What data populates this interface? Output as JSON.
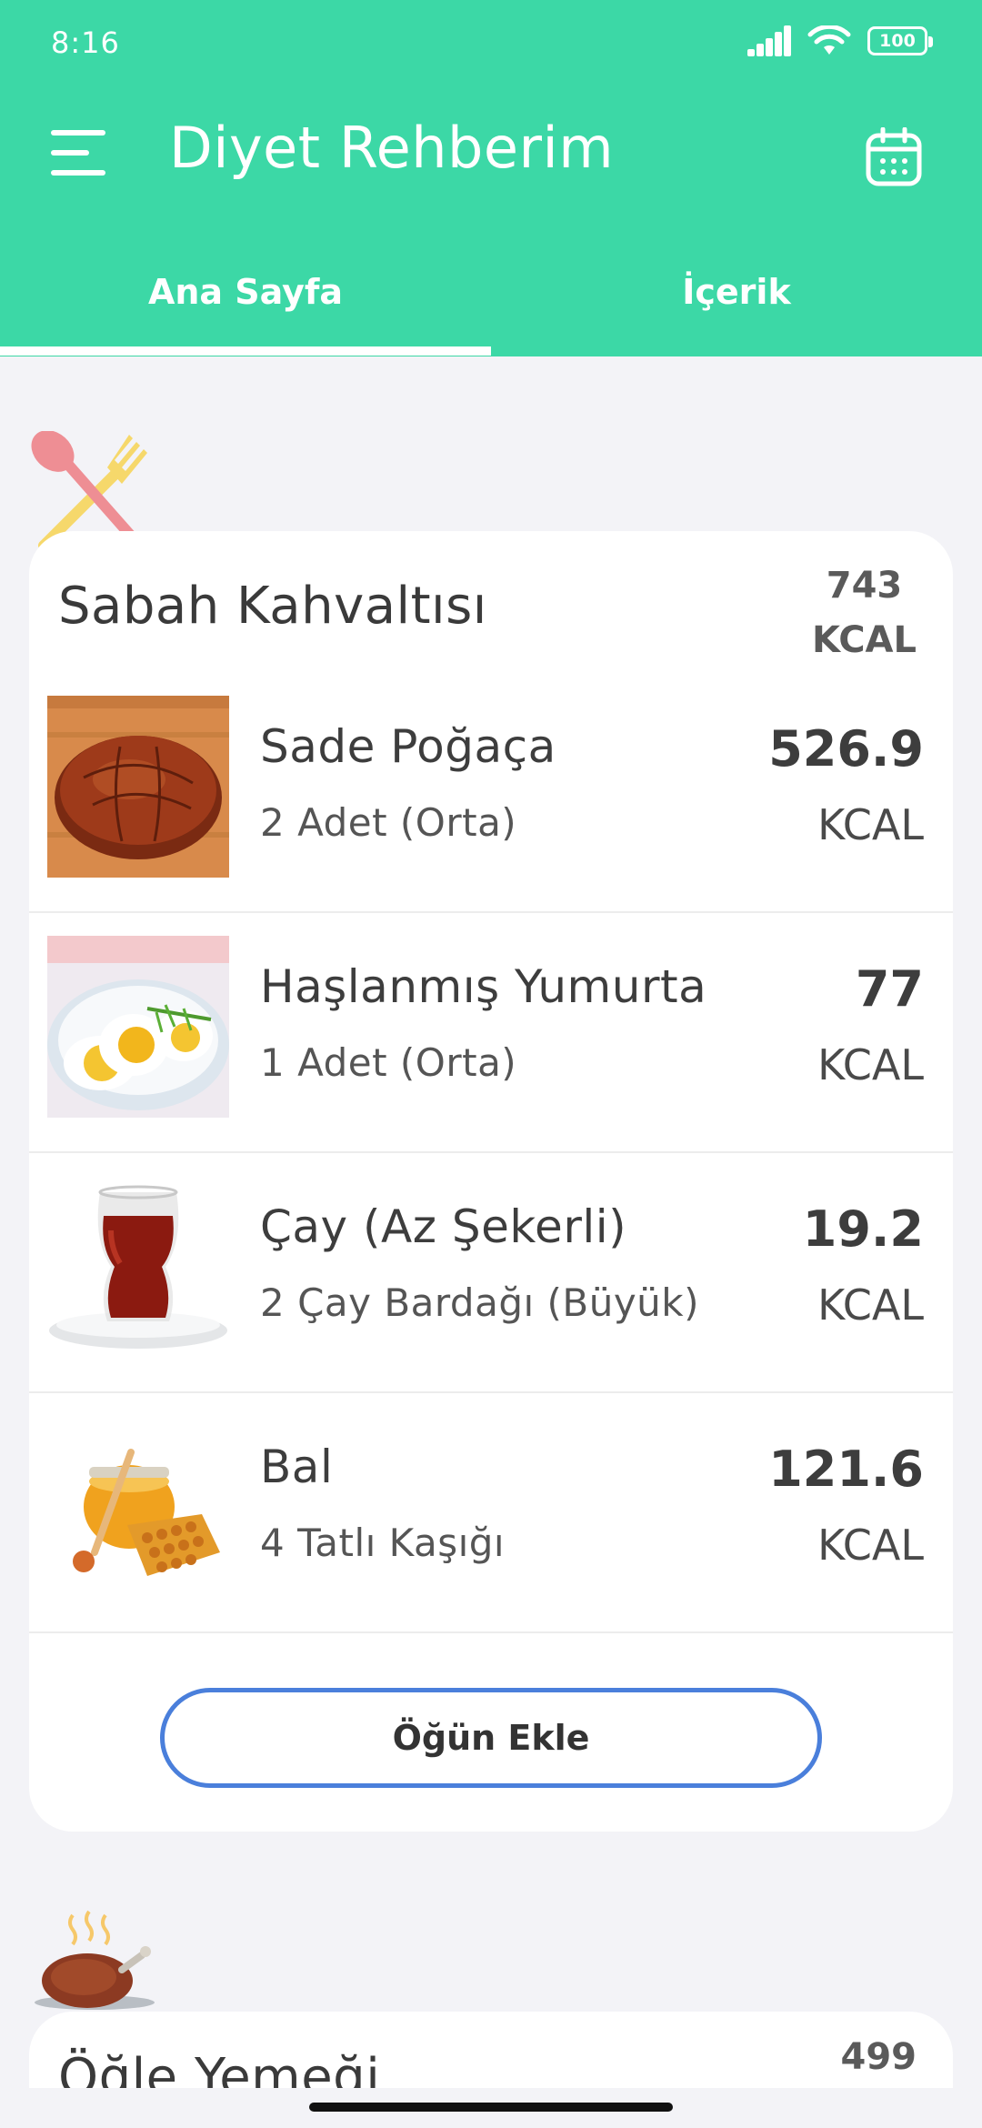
{
  "status_bar": {
    "time": "8:16",
    "battery": "100"
  },
  "app": {
    "title": "Diyet Rehberim"
  },
  "tabs": [
    {
      "label": "Ana Sayfa",
      "active": true
    },
    {
      "label": "İçerik",
      "active": false
    }
  ],
  "meals": [
    {
      "title": "Sabah Kahvaltısı",
      "total_kcal": "743",
      "kcal_unit": "KCAL",
      "items": [
        {
          "name": "Sade Poğaça",
          "portion": "2 Adet (Orta)",
          "kcal": "526.9",
          "unit": "KCAL"
        },
        {
          "name": "Haşlanmış Yumurta",
          "portion": "1 Adet (Orta)",
          "kcal": "77",
          "unit": "KCAL"
        },
        {
          "name": "Çay (Az Şekerli)",
          "portion": "2 Çay Bardağı (Büyük)",
          "kcal": "19.2",
          "unit": "KCAL"
        },
        {
          "name": "Bal",
          "portion": "4 Tatlı Kaşığı",
          "kcal": "121.6",
          "unit": "KCAL"
        }
      ],
      "add_button": "Öğün Ekle"
    },
    {
      "title": "Öğle Yemeği",
      "total_kcal": "499"
    }
  ],
  "colors": {
    "header": "#3CD8A6",
    "button_border": "#4A7FDB",
    "background": "#F3F3F7"
  },
  "icons": [
    "menu-icon",
    "calendar-icon",
    "signal-icon",
    "wifi-icon",
    "battery-icon",
    "cutlery-icon",
    "roast-chicken-icon"
  ]
}
